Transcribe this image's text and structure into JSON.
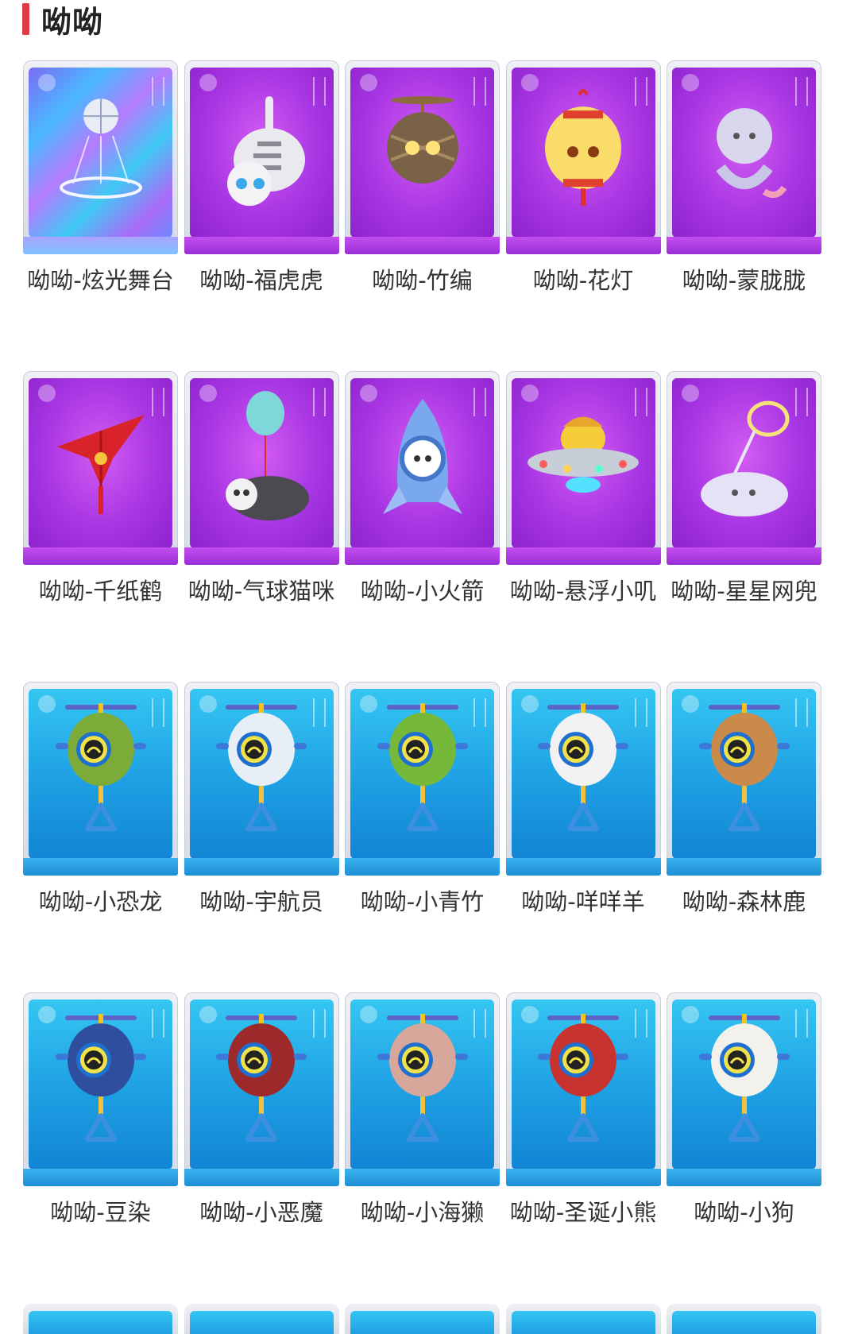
{
  "section": {
    "title": "呦呦",
    "accent_color": "#e03a45"
  },
  "items": [
    {
      "label": "呦呦-炫光舞台",
      "theme": "holo",
      "icon": "disco-ball-stage-icon"
    },
    {
      "label": "呦呦-福虎虎",
      "theme": "purple",
      "icon": "tiger-icon"
    },
    {
      "label": "呦呦-竹编",
      "theme": "purple",
      "icon": "bamboo-ball-icon"
    },
    {
      "label": "呦呦-花灯",
      "theme": "purple",
      "icon": "lantern-icon"
    },
    {
      "label": "呦呦-蒙胧胧",
      "theme": "purple",
      "icon": "dragon-icon"
    },
    {
      "label": "呦呦-千纸鹤",
      "theme": "purple",
      "icon": "paper-crane-icon"
    },
    {
      "label": "呦呦-气球猫咪",
      "theme": "purple",
      "icon": "balloon-cat-icon"
    },
    {
      "label": "呦呦-小火箭",
      "theme": "purple",
      "icon": "rocket-icon"
    },
    {
      "label": "呦呦-悬浮小叽",
      "theme": "purple",
      "icon": "ufo-chick-icon"
    },
    {
      "label": "呦呦-星星网兜",
      "theme": "purple",
      "icon": "cloud-net-icon"
    },
    {
      "label": "呦呦-小恐龙",
      "theme": "blue",
      "icon": "robot-dino-icon",
      "body_color": "#7cab3a"
    },
    {
      "label": "呦呦-宇航员",
      "theme": "blue",
      "icon": "robot-astronaut-icon",
      "body_color": "#e8eef5"
    },
    {
      "label": "呦呦-小青竹",
      "theme": "blue",
      "icon": "robot-bamboo-icon",
      "body_color": "#76b83a"
    },
    {
      "label": "呦呦-咩咩羊",
      "theme": "blue",
      "icon": "robot-sheep-icon",
      "body_color": "#f2f2f4"
    },
    {
      "label": "呦呦-森林鹿",
      "theme": "blue",
      "icon": "robot-deer-icon",
      "body_color": "#c98a4a"
    },
    {
      "label": "呦呦-豆染",
      "theme": "blue",
      "icon": "robot-indigo-icon",
      "body_color": "#2f4f9e"
    },
    {
      "label": "呦呦-小恶魔",
      "theme": "blue",
      "icon": "robot-devil-icon",
      "body_color": "#9c2a2a"
    },
    {
      "label": "呦呦-小海獭",
      "theme": "blue",
      "icon": "robot-otter-icon",
      "body_color": "#d6a79a"
    },
    {
      "label": "呦呦-圣诞小熊",
      "theme": "blue",
      "icon": "robot-xmas-bear-icon",
      "body_color": "#c8322f"
    },
    {
      "label": "呦呦-小狗",
      "theme": "blue",
      "icon": "robot-dog-icon",
      "body_color": "#f3f1ec"
    }
  ]
}
